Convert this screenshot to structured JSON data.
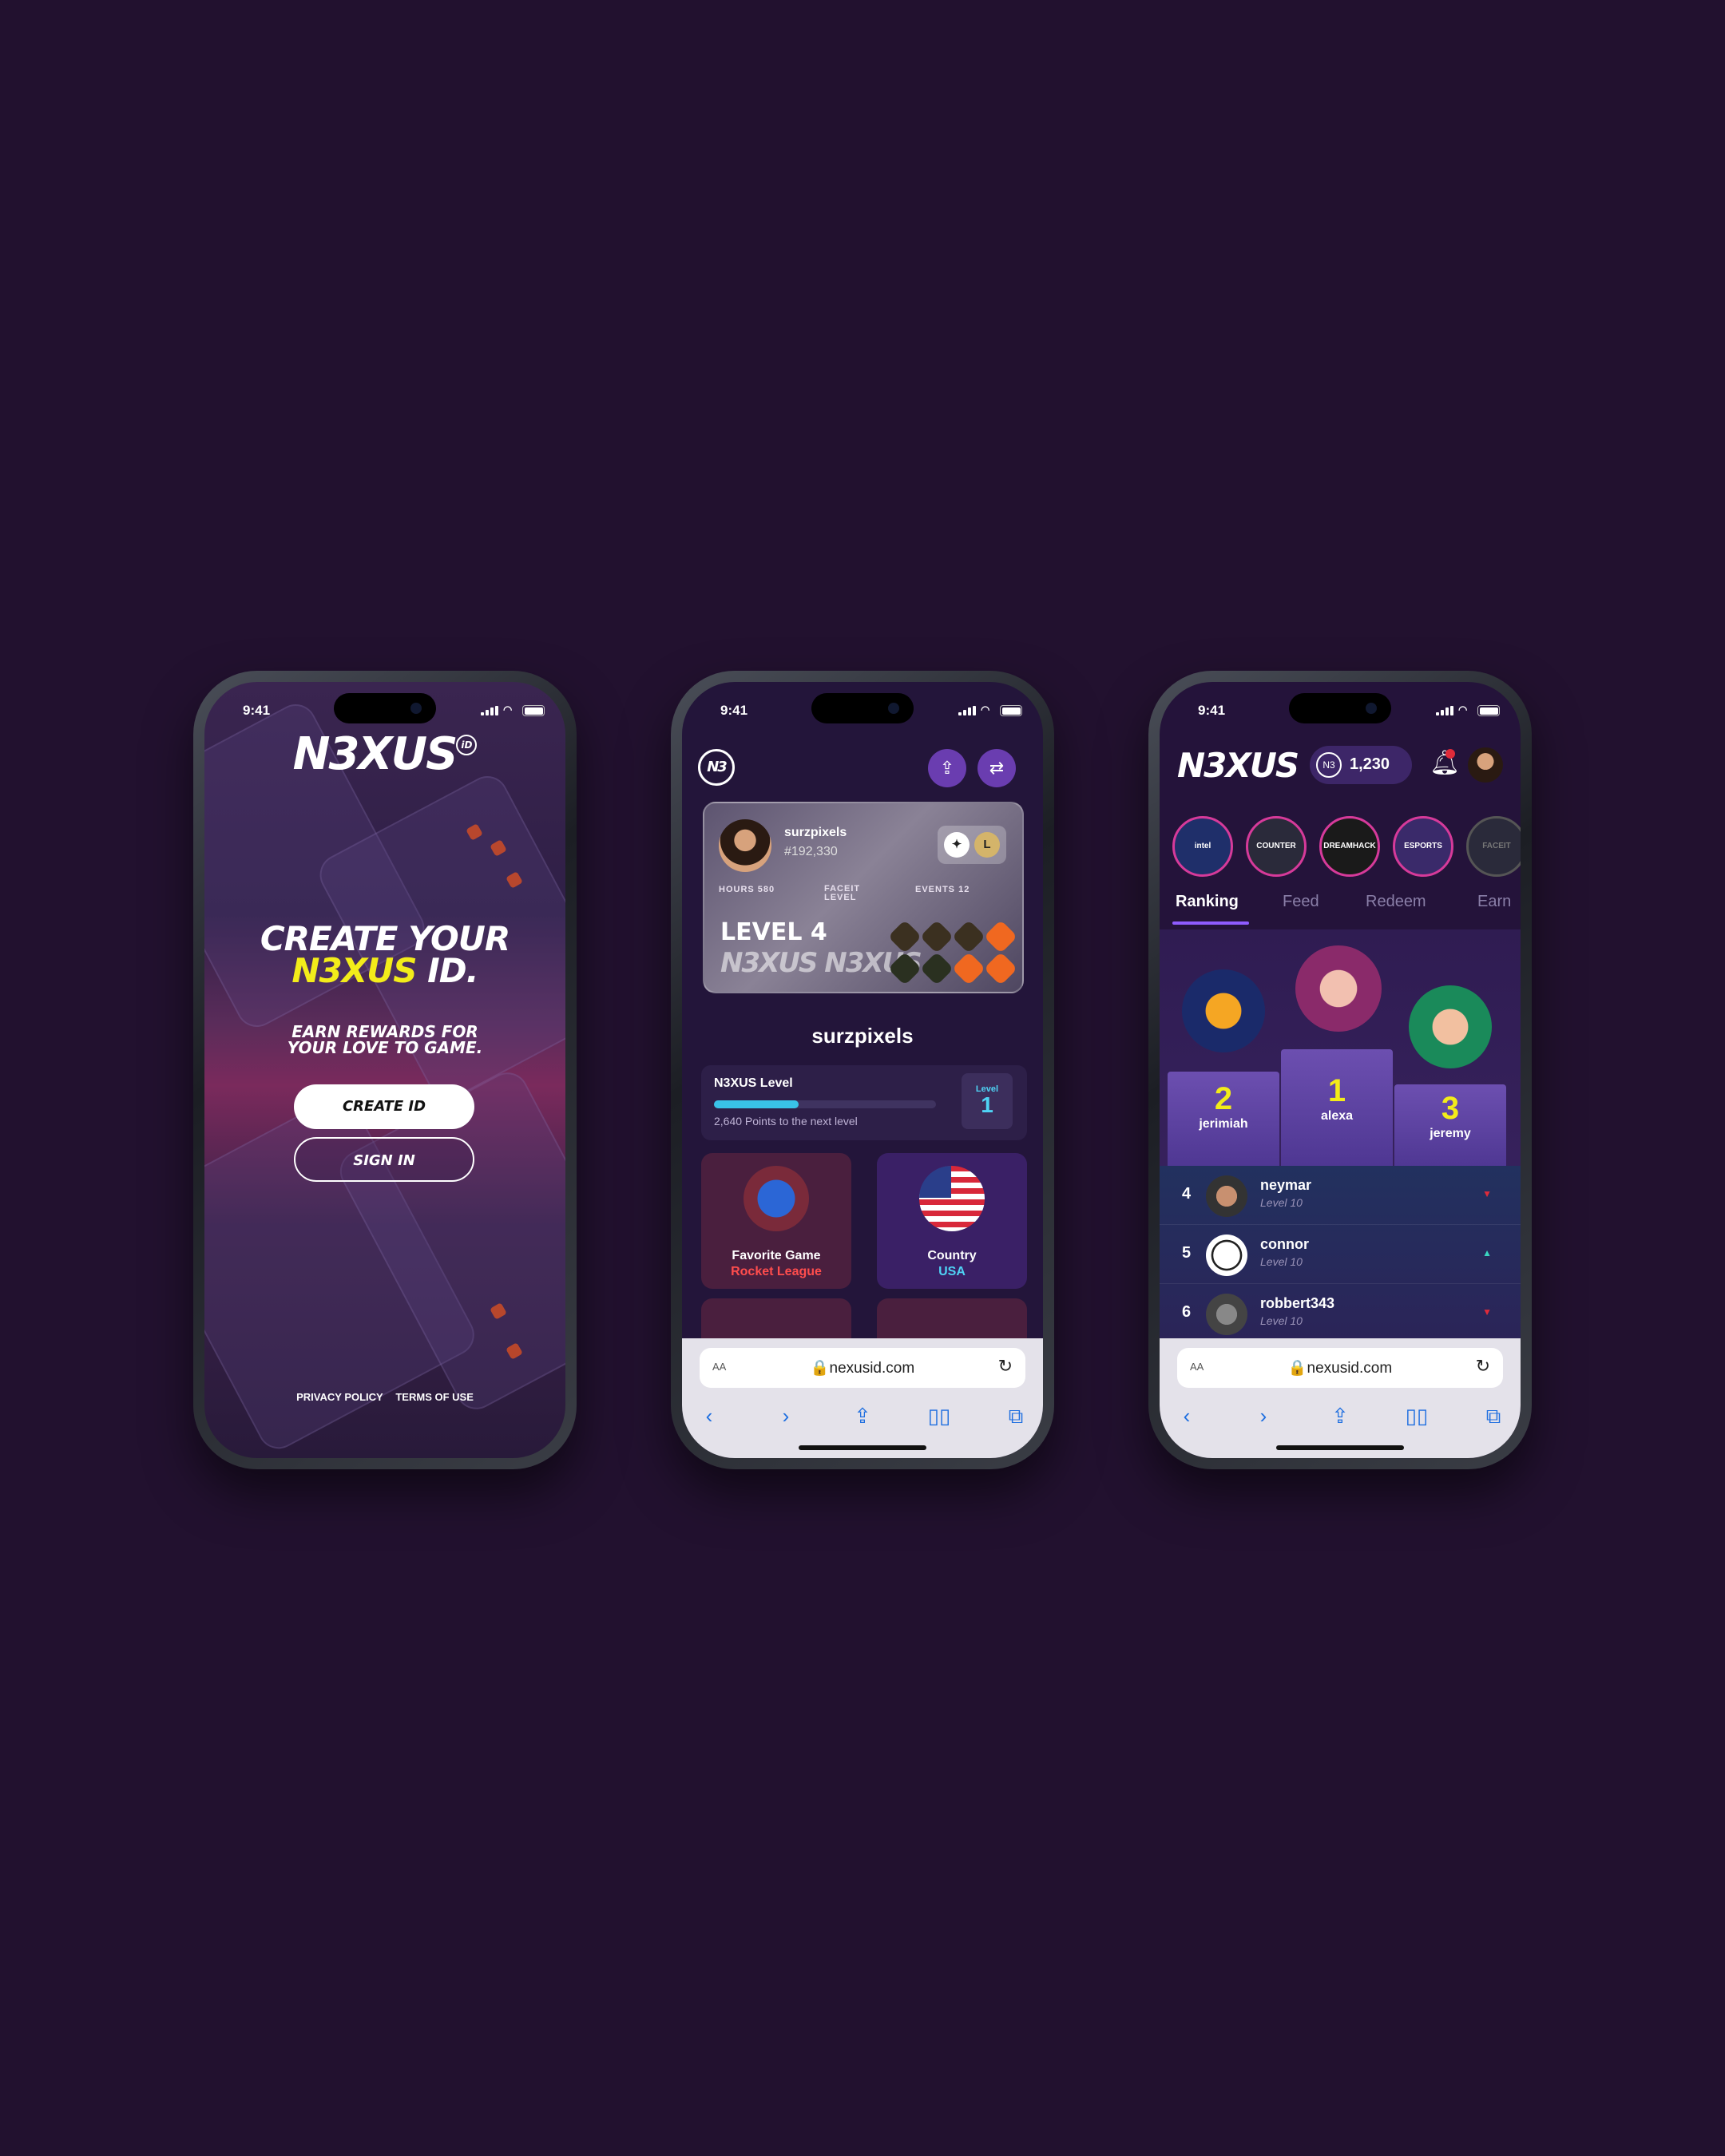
{
  "status": {
    "time": "9:41"
  },
  "phone1": {
    "logo": "N3XUS",
    "logo_badge": "iD",
    "headline_line1": "CREATE YOUR",
    "headline_brand": "N3XUS",
    "headline_suffix": " ID.",
    "subtitle_line1": "EARN REWARDS FOR",
    "subtitle_line2": "YOUR LOVE TO GAME.",
    "create_label": "CREATE ID",
    "signin_label": "SIGN IN",
    "privacy": "PRIVACY POLICY",
    "terms": "TERMS OF USE"
  },
  "phone2": {
    "logo": "N3",
    "card": {
      "username": "surzpixels",
      "number": "#192,330",
      "hours_label": "HOURS",
      "hours_value": "580",
      "faceit_label": "FACEIT LEVEL",
      "events_label": "EVENTS",
      "events_value": "12",
      "level": "LEVEL 4",
      "brand": "N3XUS N3XUS"
    },
    "username": "surzpixels",
    "level_title": "N3XUS Level",
    "level_progress": 0.38,
    "level_points": "2,640 Points to the next level",
    "level_badge_label": "Level",
    "level_badge_value": "1",
    "tiles": [
      {
        "label": "Favorite Game",
        "value": "Rocket League"
      },
      {
        "label": "Country",
        "value": "USA"
      }
    ]
  },
  "browser": {
    "aa": "AA",
    "url": "nexusid.com"
  },
  "phone3": {
    "logo": "N3XUS",
    "coins": "1,230",
    "stories": [
      "intel",
      "COUNTER STRIKE",
      "DREAMHACK",
      "ESPORTS WORLD CUP",
      "FACEIT"
    ],
    "tabs": [
      "Ranking",
      "Feed",
      "Redeem",
      "Earn"
    ],
    "podium": [
      {
        "rank": "2",
        "name": "jerimiah"
      },
      {
        "rank": "1",
        "name": "alexa"
      },
      {
        "rank": "3",
        "name": "jeremy"
      }
    ],
    "rows": [
      {
        "rank": "4",
        "name": "neymar",
        "level": "Level 10",
        "trend": "down"
      },
      {
        "rank": "5",
        "name": "connor",
        "level": "Level 10",
        "trend": "up"
      },
      {
        "rank": "6",
        "name": "robbert343",
        "level": "Level 10",
        "trend": "down"
      }
    ]
  },
  "colors": {
    "accent_yellow": "#f3ec1a",
    "accent_purple": "#6a3db0",
    "link_blue": "#1f6fe0",
    "rocket_red": "#ff4d4d",
    "usa_cyan": "#4fd3f5"
  }
}
